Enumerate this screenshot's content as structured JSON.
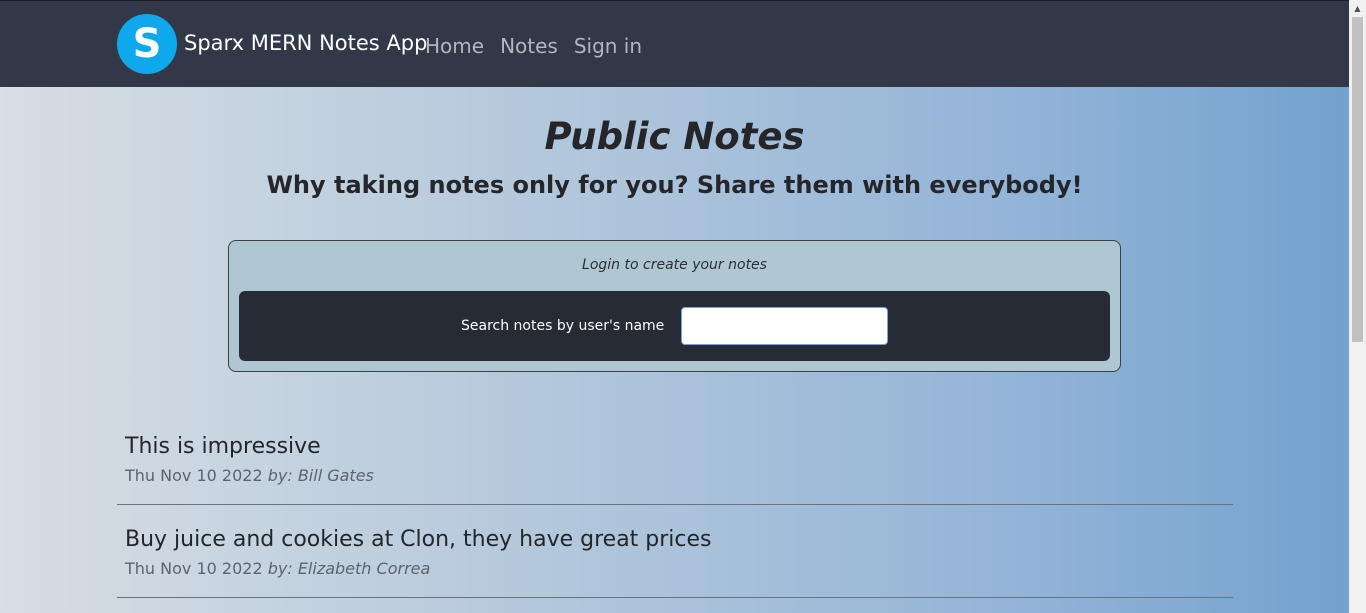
{
  "navbar": {
    "logo_letter": "S",
    "brand": "Sparx MERN Notes App",
    "links": [
      "Home",
      "Notes",
      "Sign in"
    ]
  },
  "header": {
    "title": "Public Notes",
    "subtitle": "Why taking notes only for you? Share them with everybody!"
  },
  "notice": {
    "text": "Login to create your notes"
  },
  "search": {
    "label": "Search notes by user's name",
    "value": "",
    "placeholder": ""
  },
  "notes": [
    {
      "title": "This is impressive",
      "date": "Thu Nov 10 2022",
      "by": "by: Bill Gates"
    },
    {
      "title": "Buy juice and cookies at Clon, they have great prices",
      "date": "Thu Nov 10 2022",
      "by": "by: Elizabeth Correa"
    }
  ],
  "colors": {
    "navbar": "#323848",
    "logo": "#0ea8ec",
    "search_panel": "#272b36"
  }
}
